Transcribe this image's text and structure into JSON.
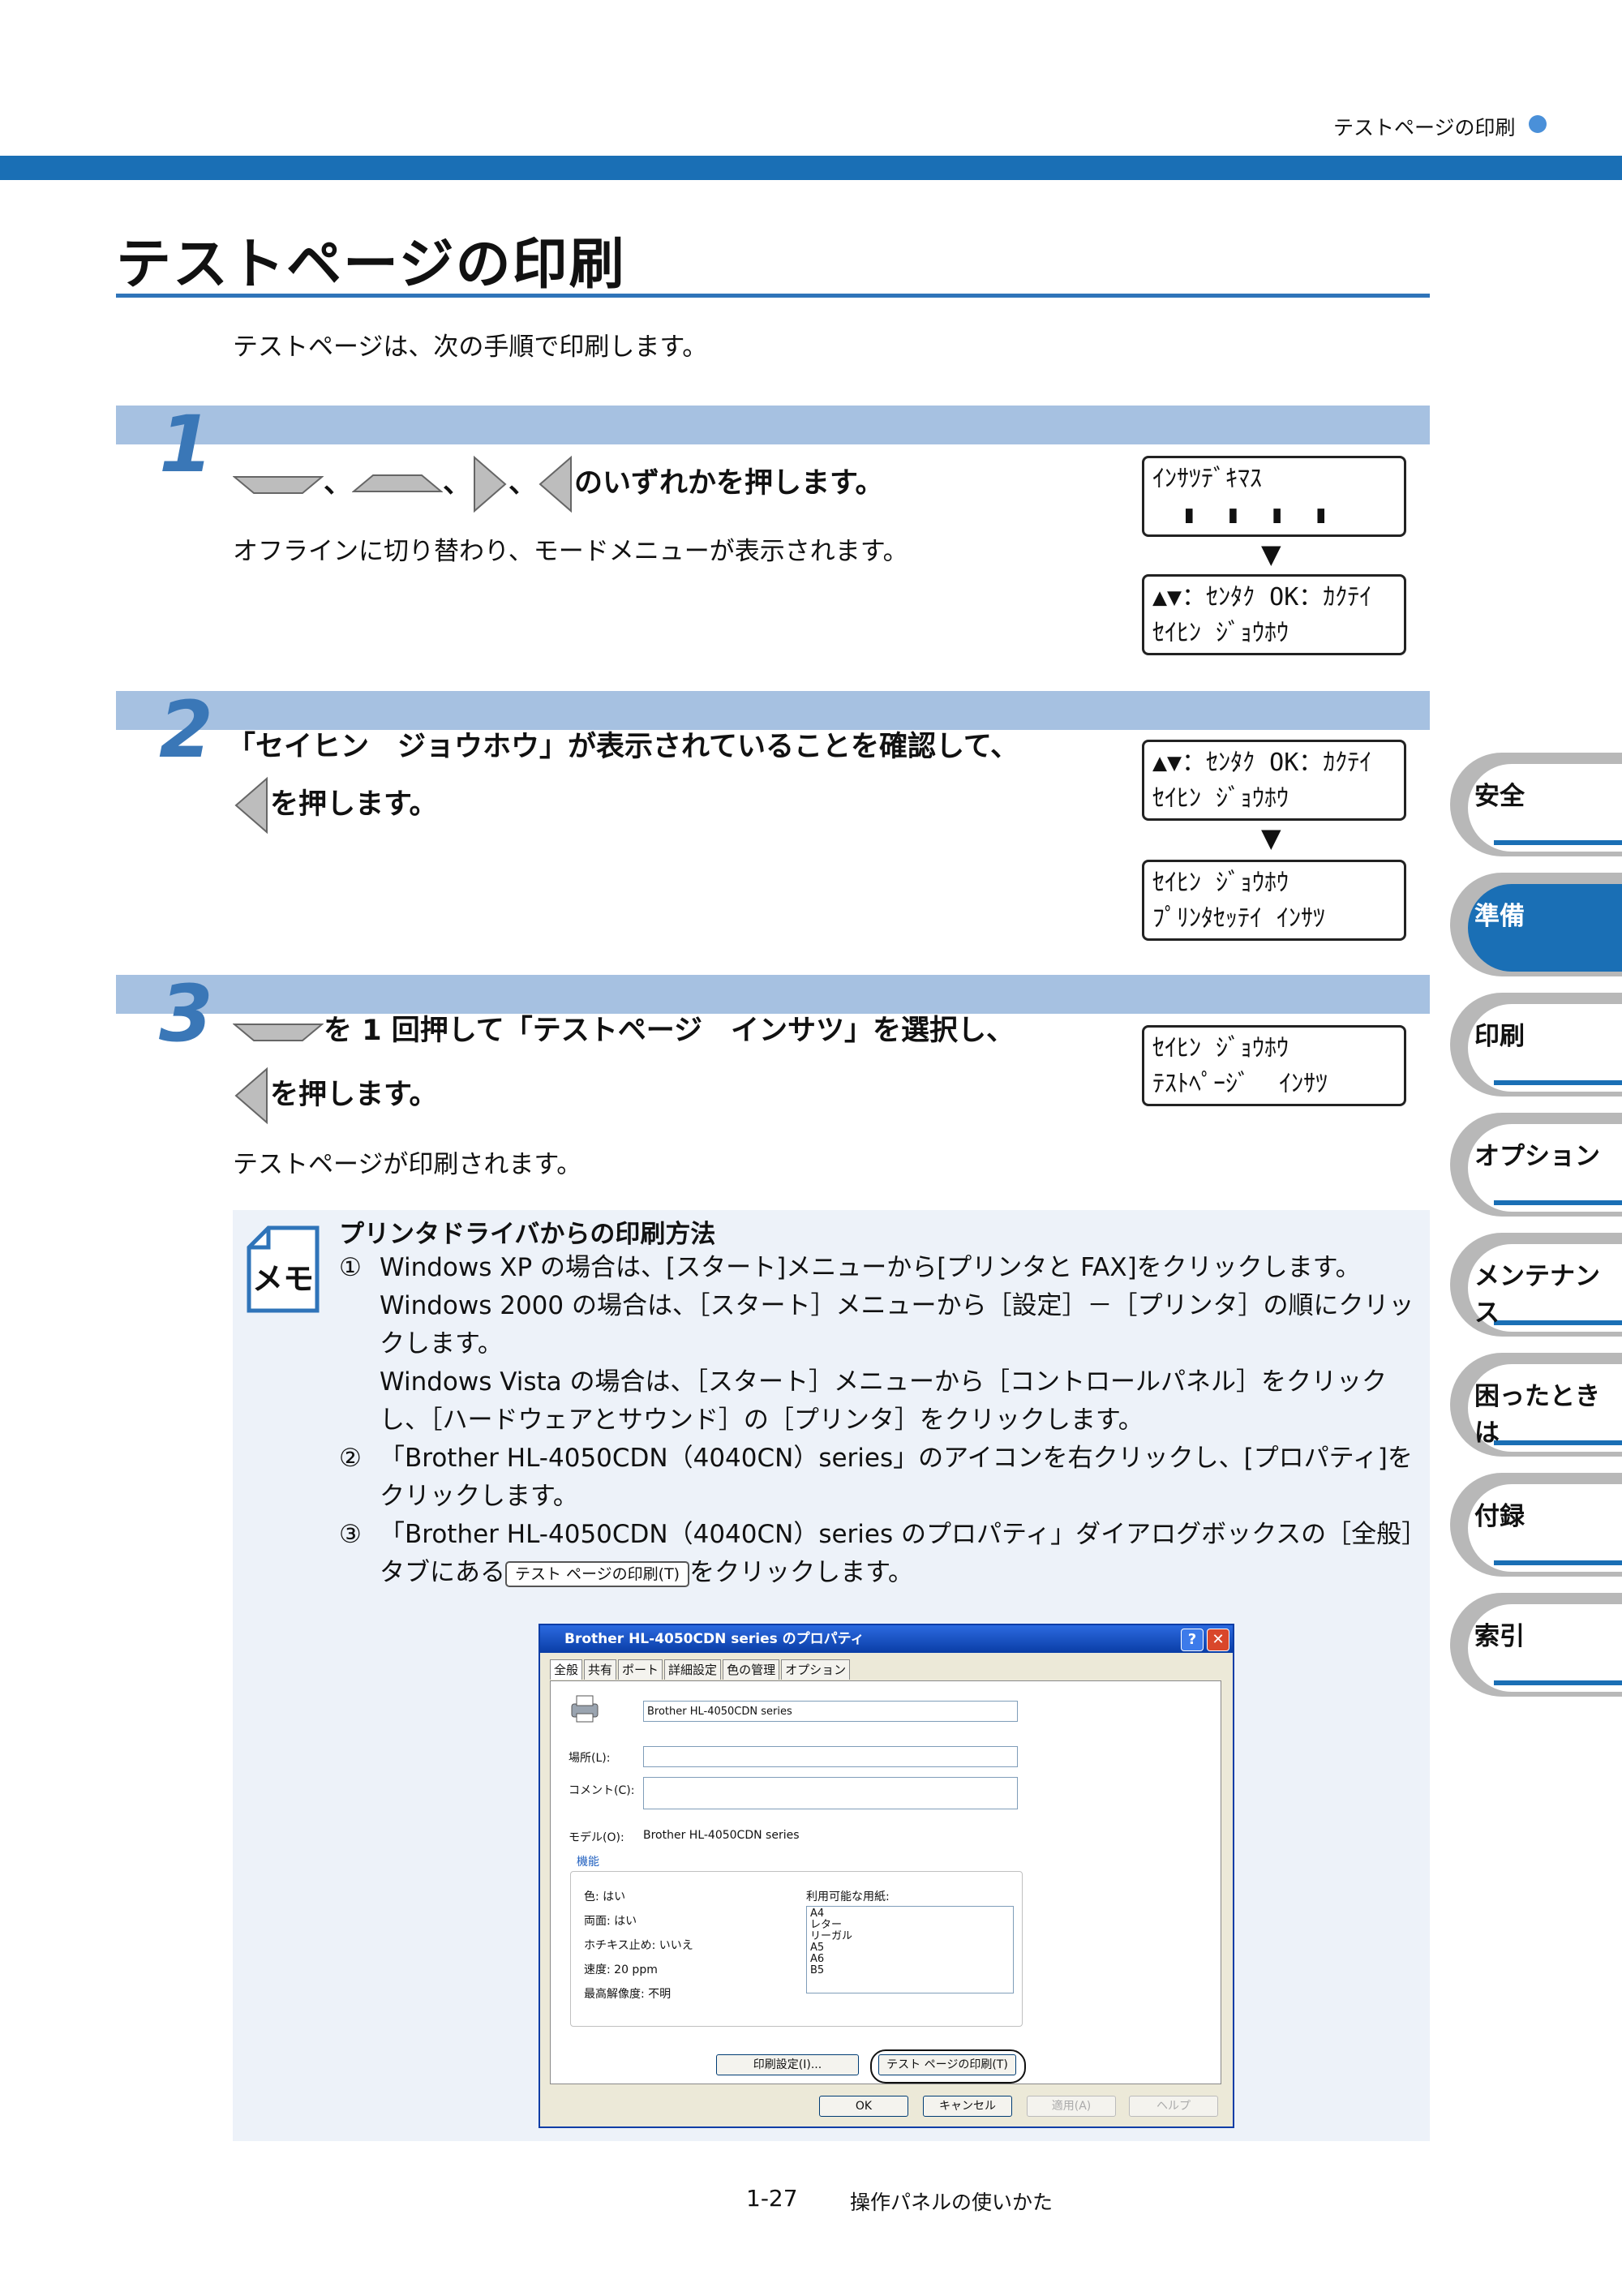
{
  "header": {
    "section": "テストページの印刷"
  },
  "title": "テストページの印刷",
  "intro": "テストページは、次の手順で印刷します。",
  "steps": [
    {
      "num": "1",
      "text": "のいずれかを押します。",
      "sep": "、",
      "sub": "オフラインに切り替わり、モードメニューが表示されます。"
    },
    {
      "num": "2",
      "line1": "「セイヒン　ジョウホウ」が表示されていることを確認して、",
      "line2": "を押します。"
    },
    {
      "num": "3",
      "line1_a": "を",
      "line1_b": "1",
      "line1_c": "回押して「テストページ　インサツ」を選択し、",
      "line2": "を押します。",
      "sub": "テストページが印刷されます。"
    }
  ],
  "lcd": {
    "s1a": [
      "ｲﾝｻﾂﾃﾞｷﾏｽ",
      "  ▮  ▮  ▮  ▮"
    ],
    "s1b": [
      "▲▼：ｾﾝﾀｸ OK：ｶｸﾃｲ",
      "ｾｲﾋﾝ ｼﾞｮｳﾎｳ"
    ],
    "s2a": [
      "▲▼：ｾﾝﾀｸ OK：ｶｸﾃｲ",
      "ｾｲﾋﾝ ｼﾞｮｳﾎｳ"
    ],
    "s2b": [
      "ｾｲﾋﾝ ｼﾞｮｳﾎｳ",
      "ﾌﾟﾘﾝﾀｾｯﾃｲ ｲﾝｻﾂ"
    ],
    "s3a": [
      "ｾｲﾋﾝ ｼﾞｮｳﾎｳ",
      "ﾃｽﾄﾍﾟｰｼﾞ  ｲﾝｻﾂ"
    ],
    "arrow": "▼"
  },
  "memo": {
    "icon_label": "メモ",
    "title": "プリンタドライバからの印刷方法",
    "items": [
      {
        "num": "①",
        "text": "Windows XP の場合は、[スタート]メニューから[プリンタと FAX]をクリックします。"
      },
      {
        "num": "",
        "text": "Windows 2000 の場合は、［スタート］メニューから［設定］－［プリンタ］の順にクリックします。"
      },
      {
        "num": "",
        "text": "Windows Vista の場合は、［スタート］メニューから［コントロールパネル］をクリックし、［ハードウェアとサウンド］の［プリンタ］をクリックします。"
      },
      {
        "num": "②",
        "text": "「Brother HL-4050CDN（4040CN）series」のアイコンを右クリックし、[プロパティ]をクリックします。"
      },
      {
        "num": "③",
        "text_a": "「Brother HL-4050CDN（4040CN）series のプロパティ」ダイアログボックスの［全般］タブにある",
        "btn": "テスト ページの印刷(T)",
        "text_b": "をクリックします。"
      }
    ]
  },
  "dialog": {
    "title": "Brother HL-4050CDN series のプロパティ",
    "help": "?",
    "close": "✕",
    "tabs": [
      "全般",
      "共有",
      "ポート",
      "詳細設定",
      "色の管理",
      "オプション"
    ],
    "printer_name": "Brother HL-4050CDN series",
    "location_label": "場所(L):",
    "comment_label": "コメント(C):",
    "model_label": "モデル(O):",
    "model_value": "Brother HL-4050CDN series",
    "features_label": "機能",
    "features": [
      "色: はい",
      "両面: はい",
      "ホチキス止め: いいえ",
      "速度: 20 ppm",
      "最高解像度: 不明"
    ],
    "paper_label": "利用可能な用紙:",
    "papers": [
      "A4",
      "レター",
      "リーガル",
      "A5",
      "A6",
      "B5"
    ],
    "btn_prefs": "印刷設定(I)...",
    "btn_test": "テスト ページの印刷(T)",
    "btn_ok": "OK",
    "btn_cancel": "キャンセル",
    "btn_apply": "適用(A)",
    "btn_help": "ヘルプ"
  },
  "side_tabs": [
    "安全",
    "準備",
    "印刷",
    "オプション",
    "メンテナンス",
    "困ったときは",
    "付録",
    "索引"
  ],
  "footer": {
    "page": "1-27",
    "title": "操作パネルの使いかた"
  },
  "colors": {
    "accent": "#1a6fb5",
    "band": "#a6c1e1",
    "memo_bg": "#edf2f9"
  }
}
